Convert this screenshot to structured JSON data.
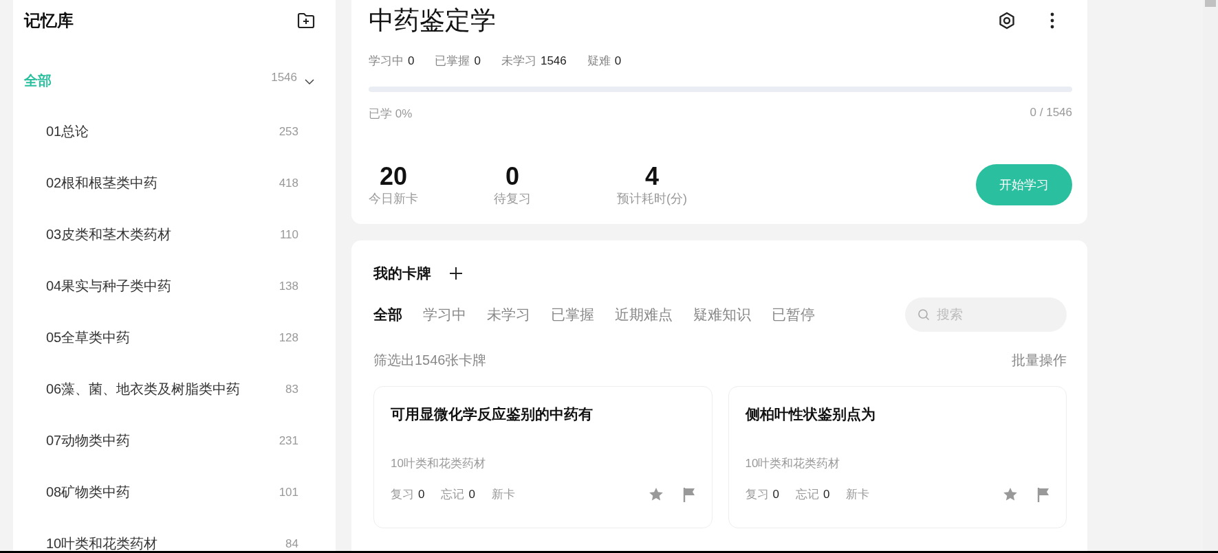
{
  "sidebar": {
    "title": "记忆库",
    "tree": [
      {
        "label": "全部",
        "count": "1546",
        "selected": true,
        "expanded": true,
        "children": [
          {
            "label": "01总论",
            "count": "253",
            "selected": false
          },
          {
            "label": "02根和根茎类中药",
            "count": "418",
            "selected": false
          },
          {
            "label": "03皮类和茎木类药材",
            "count": "110",
            "selected": false
          },
          {
            "label": "04果实与种子类中药",
            "count": "138",
            "selected": false
          },
          {
            "label": "05全草类中药",
            "count": "128",
            "selected": false
          },
          {
            "label": "06藻、菌、地衣类及树脂类中药",
            "count": "83",
            "selected": false
          },
          {
            "label": "07动物类中药",
            "count": "231",
            "selected": false
          },
          {
            "label": "08矿物类中药",
            "count": "101",
            "selected": false
          },
          {
            "label": "10叶类和花类药材",
            "count": "84",
            "selected": false
          }
        ]
      }
    ]
  },
  "deck": {
    "title": "中药鉴定学",
    "stats": [
      {
        "label": "学习中",
        "value": "0"
      },
      {
        "label": "已掌握",
        "value": "0"
      },
      {
        "label": "未学习",
        "value": "1546"
      },
      {
        "label": "疑难",
        "value": "0"
      }
    ],
    "progress": {
      "level": 0,
      "label": "已学 0%",
      "reading": "0 / 1546"
    },
    "summary": [
      {
        "value": "20",
        "label": "今日新卡"
      },
      {
        "value": "0",
        "label": "待复习"
      },
      {
        "value": "4",
        "label": "预计耗时(分)"
      }
    ],
    "start_button": "开始学习"
  },
  "cards_panel": {
    "title": "我的卡牌",
    "tabs": [
      {
        "label": "全部",
        "selected": true
      },
      {
        "label": "学习中",
        "selected": false
      },
      {
        "label": "未学习",
        "selected": false
      },
      {
        "label": "已掌握",
        "selected": false
      },
      {
        "label": "近期难点",
        "selected": false
      },
      {
        "label": "疑难知识",
        "selected": false
      },
      {
        "label": "已暂停",
        "selected": false
      }
    ],
    "search": {
      "placeholder": "搜索"
    },
    "filter_text": "筛选出1546张卡牌",
    "batch": "批量操作",
    "cards": [
      {
        "title": "可用显微化学反应鉴别的中药有",
        "category": "10叶类和花类药材",
        "review_label": "复习",
        "review": "0",
        "forget_label": "忘记",
        "forget": "0",
        "status": "新卡"
      },
      {
        "title": "侧柏叶性状鉴别点为",
        "category": "10叶类和花类药材",
        "review_label": "复习",
        "review": "0",
        "forget_label": "忘记",
        "forget": "0",
        "status": "新卡"
      }
    ]
  }
}
